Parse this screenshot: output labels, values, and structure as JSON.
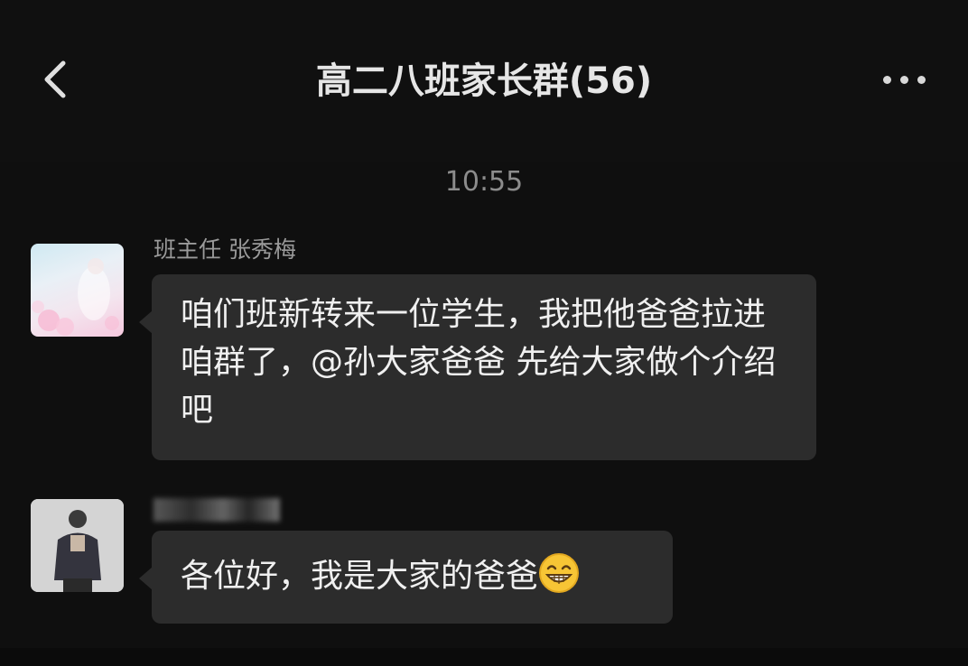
{
  "header": {
    "title": "高二八班家长群(56)",
    "back_icon": "chevron-left-icon",
    "more_icon": "more-dots-icon"
  },
  "timestamp": "10:55",
  "messages": [
    {
      "sender": "班主任 张秀梅",
      "text": "咱们班新转来一位学生，我把他爸爸拉进咱群了，@孙大家爸爸 先给大家做个介绍吧"
    },
    {
      "sender": "",
      "text": "各位好，我是大家的爸爸",
      "emoji": "grinning-face-icon"
    }
  ],
  "colors": {
    "background": "#0f0f0f",
    "bubble": "#2c2c2c",
    "text": "#f0f0f0",
    "secondary_text": "#9a9a9a"
  }
}
